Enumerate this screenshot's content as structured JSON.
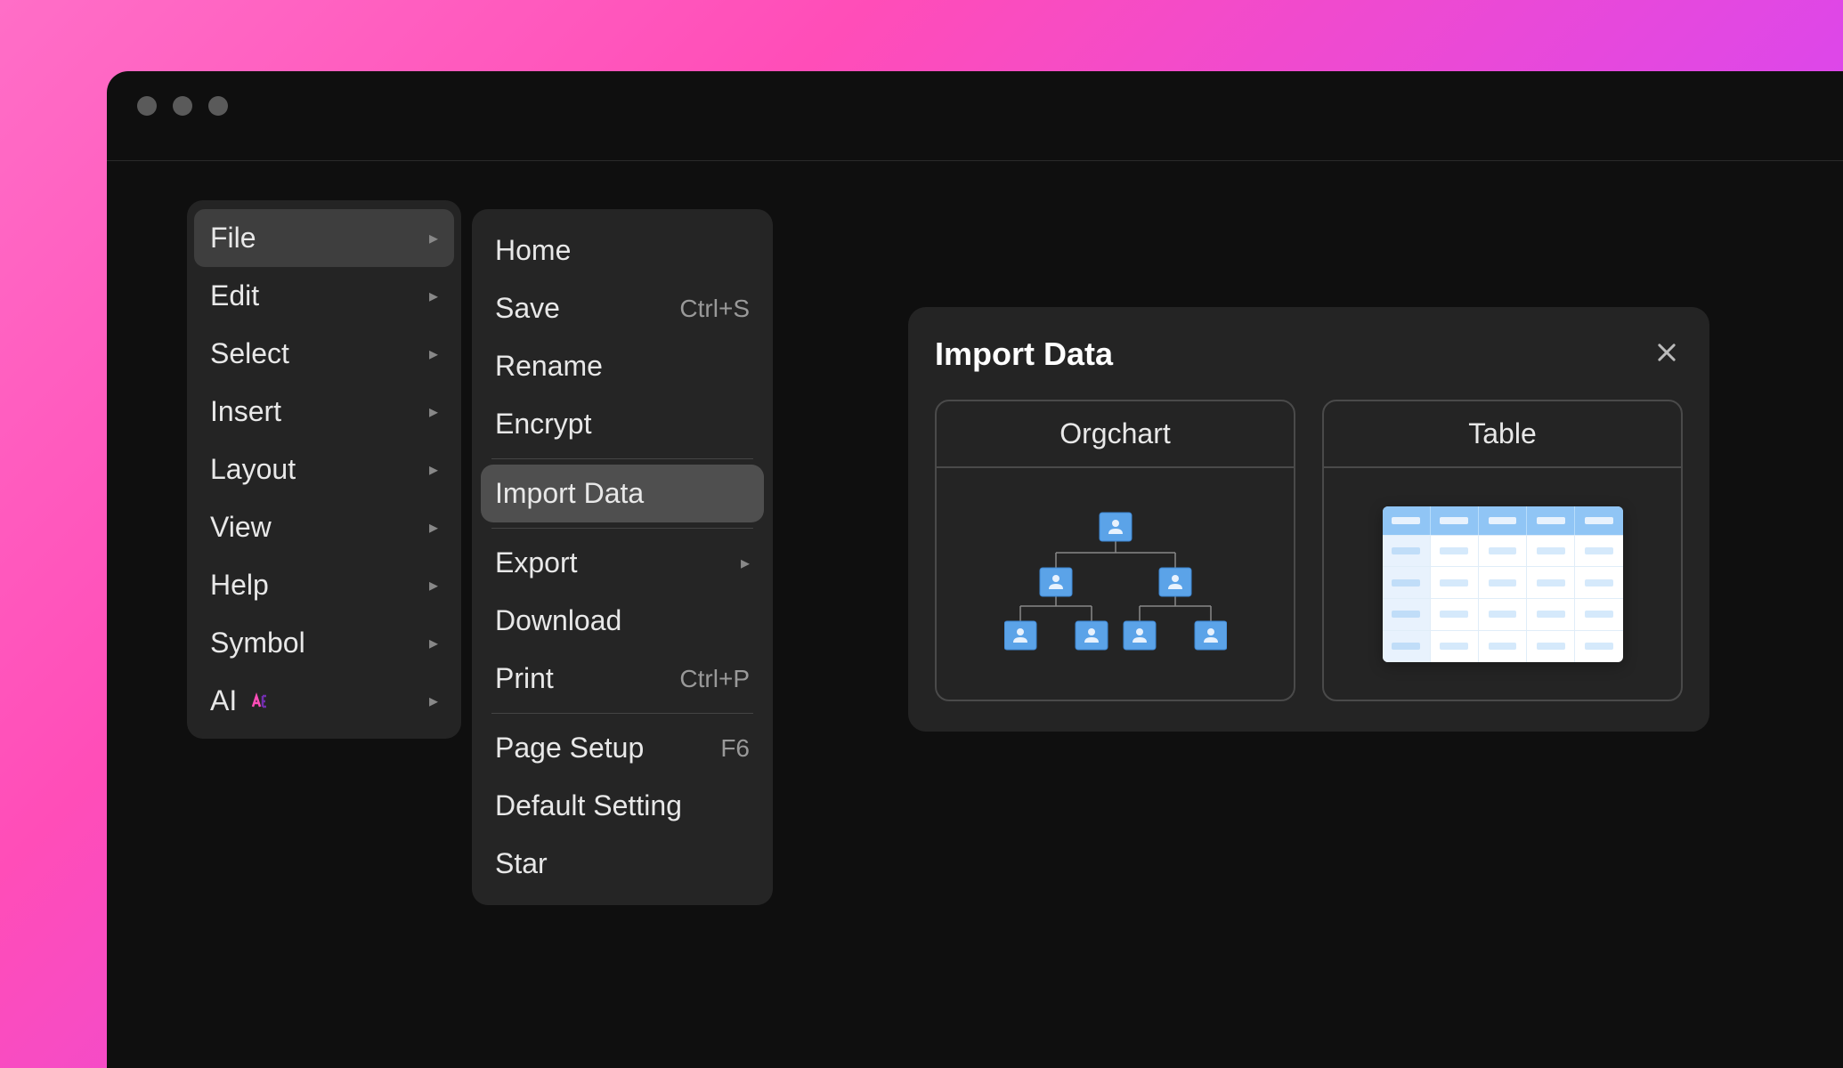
{
  "menubar": {
    "items": [
      {
        "label": "File",
        "hasSubmenu": true,
        "active": true
      },
      {
        "label": "Edit",
        "hasSubmenu": true
      },
      {
        "label": "Select",
        "hasSubmenu": true
      },
      {
        "label": "Insert",
        "hasSubmenu": true
      },
      {
        "label": "Layout",
        "hasSubmenu": true
      },
      {
        "label": "View",
        "hasSubmenu": true
      },
      {
        "label": "Help",
        "hasSubmenu": true
      },
      {
        "label": "Symbol",
        "hasSubmenu": true
      },
      {
        "label": "AI",
        "hasSubmenu": true,
        "hasIcon": true
      }
    ]
  },
  "submenu": {
    "items": [
      {
        "label": "Home"
      },
      {
        "label": "Save",
        "shortcut": "Ctrl+S"
      },
      {
        "label": "Rename"
      },
      {
        "label": "Encrypt"
      },
      {
        "separator": true
      },
      {
        "label": "Import Data",
        "highlighted": true
      },
      {
        "separator": true
      },
      {
        "label": "Export",
        "hasSubmenu": true
      },
      {
        "label": "Download"
      },
      {
        "label": "Print",
        "shortcut": "Ctrl+P"
      },
      {
        "separator": true
      },
      {
        "label": "Page Setup",
        "shortcut": "F6"
      },
      {
        "label": "Default Setting"
      },
      {
        "label": "Star"
      }
    ]
  },
  "dialog": {
    "title": "Import Data",
    "options": [
      {
        "label": "Orgchart",
        "type": "orgchart"
      },
      {
        "label": "Table",
        "type": "table"
      }
    ]
  }
}
